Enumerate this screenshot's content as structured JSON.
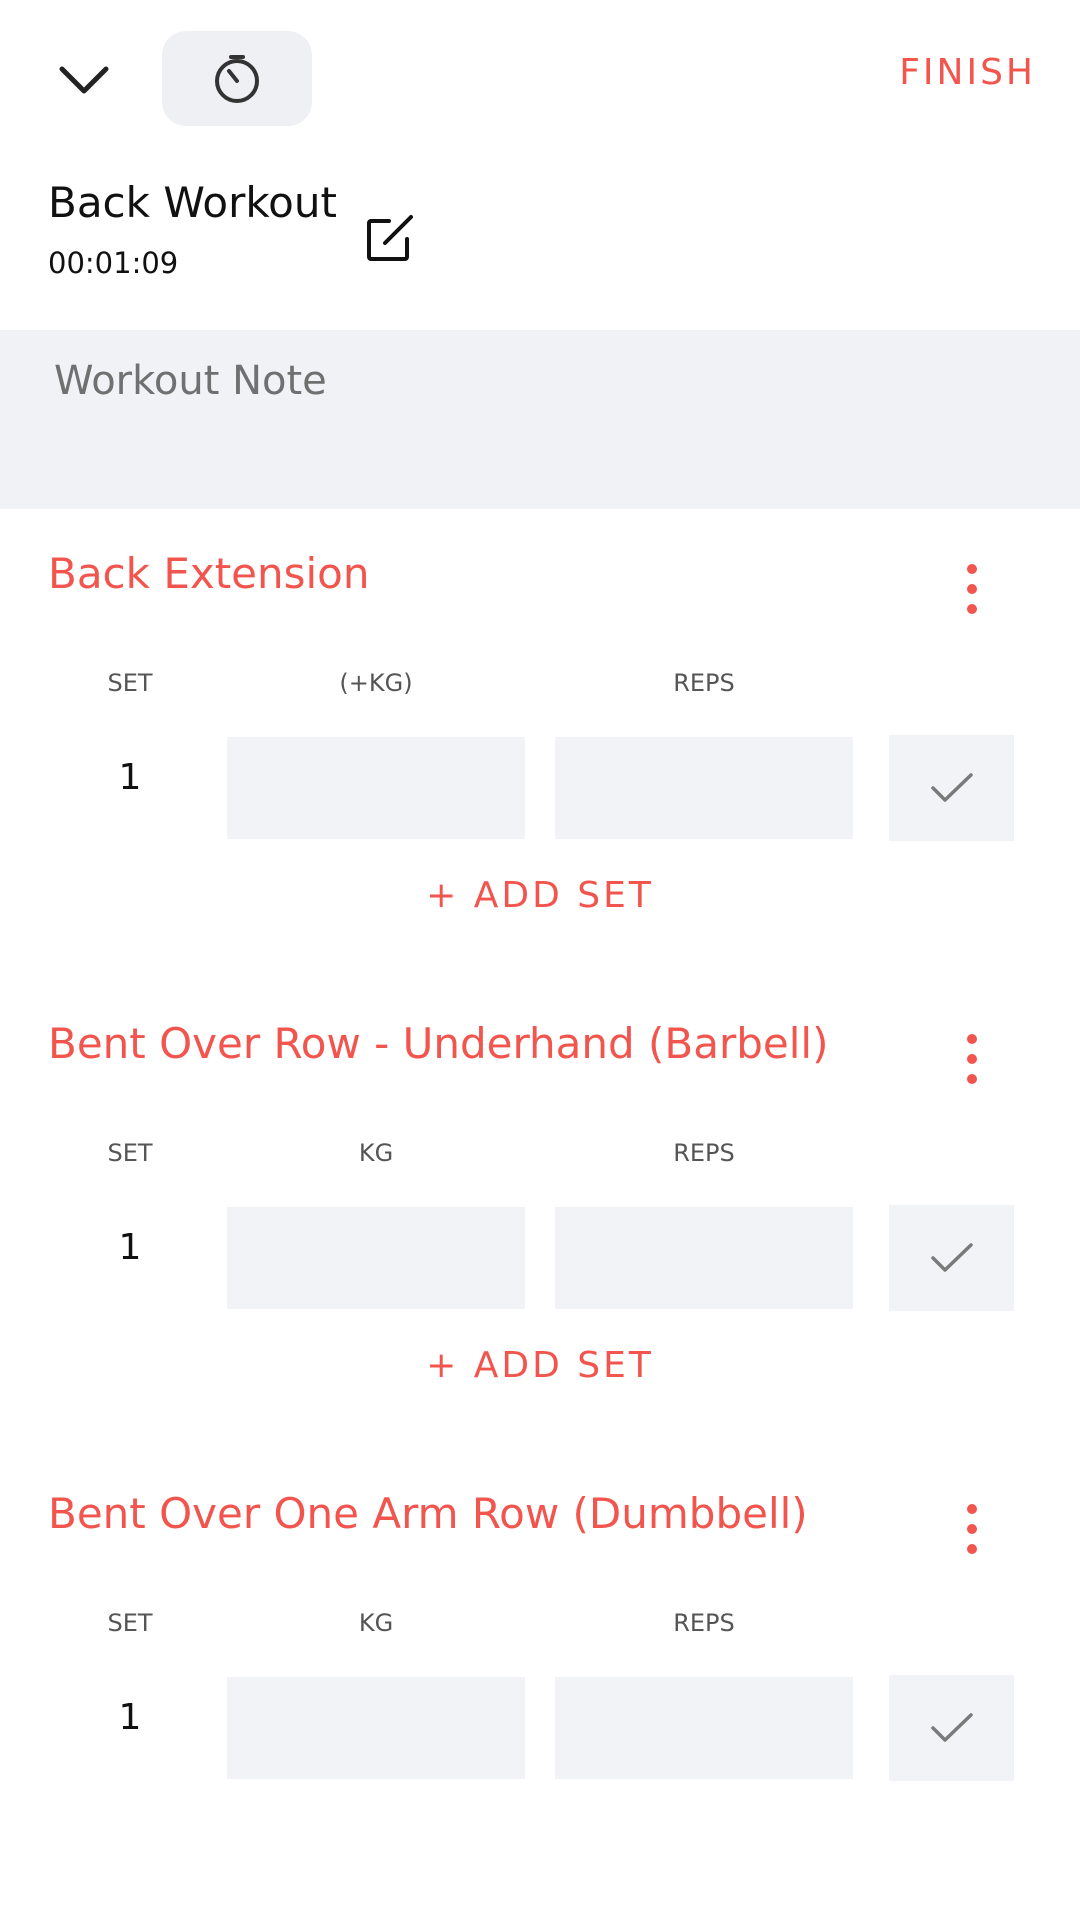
{
  "header": {
    "collapse_icon": "chevron-down-icon",
    "timer_icon": "stopwatch-icon",
    "finish_label": "FINISH"
  },
  "workout": {
    "title": "Back Workout",
    "elapsed": "00:01:09",
    "edit_icon": "edit-icon"
  },
  "note": {
    "placeholder": "Workout Note"
  },
  "exercises": [
    {
      "name": "Back Extension",
      "columns": {
        "set": "SET",
        "weight": "(+KG)",
        "reps": "REPS"
      },
      "sets": [
        {
          "number": "1",
          "weight": "",
          "reps": ""
        }
      ],
      "add_set_label": "+ ADD SET"
    },
    {
      "name": "Bent Over Row - Underhand (Barbell)",
      "columns": {
        "set": "SET",
        "weight": "KG",
        "reps": "REPS"
      },
      "sets": [
        {
          "number": "1",
          "weight": "",
          "reps": ""
        }
      ],
      "add_set_label": "+ ADD SET"
    },
    {
      "name": "Bent Over One Arm Row (Dumbbell)",
      "columns": {
        "set": "SET",
        "weight": "KG",
        "reps": "REPS"
      },
      "sets": [
        {
          "number": "1",
          "weight": "",
          "reps": ""
        }
      ]
    }
  ],
  "colors": {
    "accent": "#f2554d",
    "field_bg": "#f2f3f7",
    "note_bg": "#f1f2f6"
  }
}
